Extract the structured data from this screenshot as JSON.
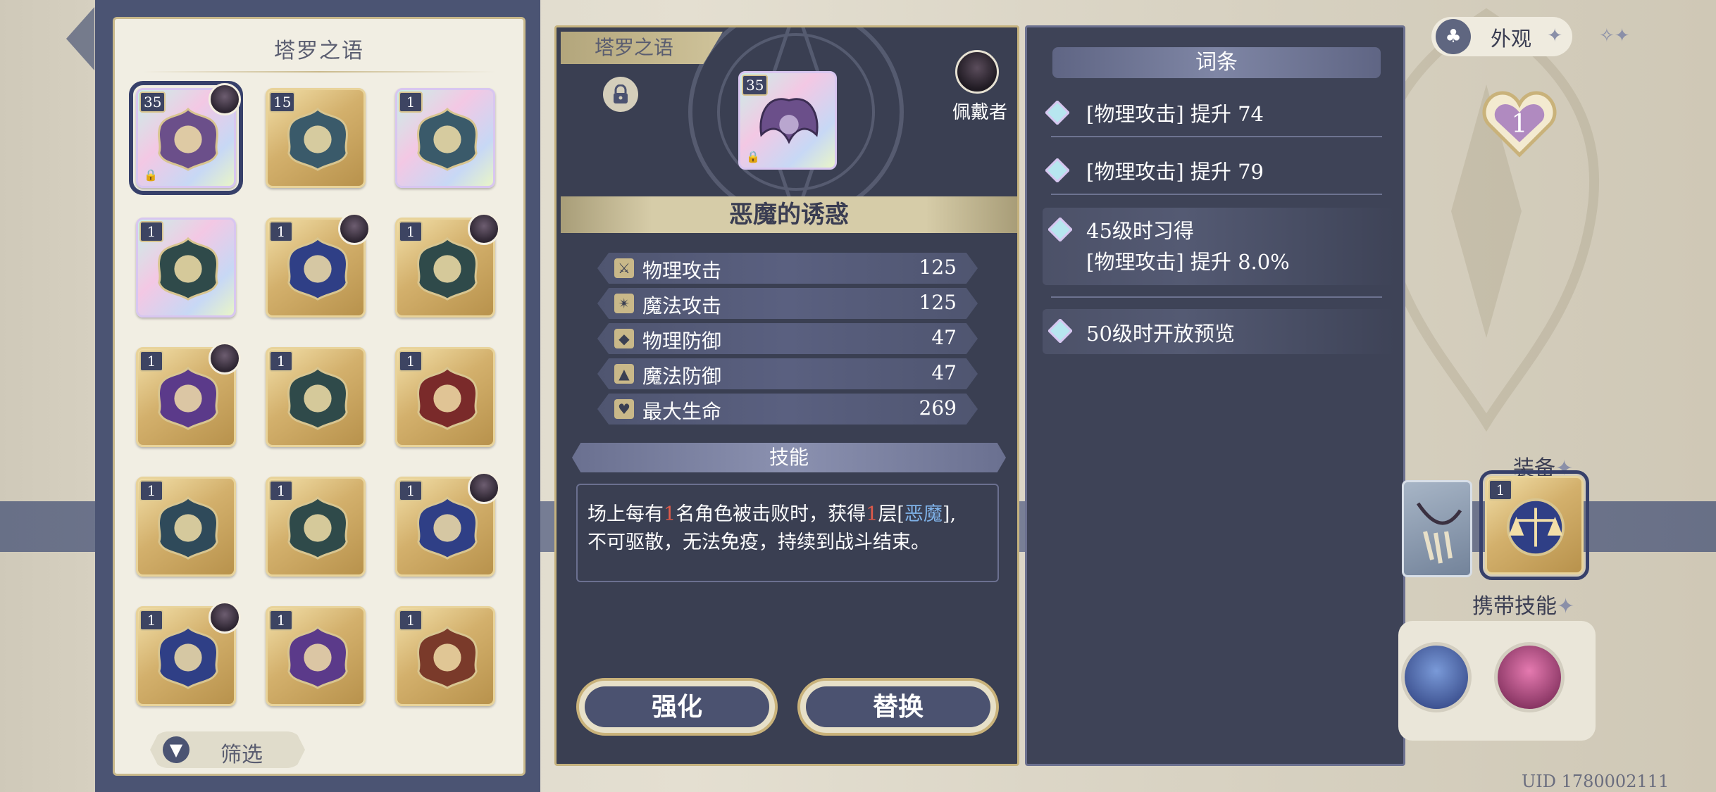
{
  "inventory": {
    "title": "塔罗之语",
    "filter_label": "筛选",
    "cards": [
      {
        "level": "35",
        "rainbow": true,
        "avatar": true,
        "lock": true,
        "selected": true,
        "motif": "demon-wing-icon"
      },
      {
        "level": "15",
        "rainbow": false,
        "avatar": false,
        "lock": false,
        "selected": false,
        "motif": "sword-icon"
      },
      {
        "level": "1",
        "rainbow": true,
        "avatar": false,
        "lock": false,
        "selected": false,
        "motif": "sword-icon"
      },
      {
        "level": "1",
        "rainbow": true,
        "avatar": false,
        "lock": false,
        "selected": false,
        "motif": "wreath-icon"
      },
      {
        "level": "1",
        "rainbow": false,
        "avatar": true,
        "lock": false,
        "selected": false,
        "motif": "scales-icon"
      },
      {
        "level": "1",
        "rainbow": false,
        "avatar": true,
        "lock": false,
        "selected": false,
        "motif": "bell-icon"
      },
      {
        "level": "1",
        "rainbow": false,
        "avatar": true,
        "lock": false,
        "selected": false,
        "motif": "moon-star-icon"
      },
      {
        "level": "1",
        "rainbow": false,
        "avatar": false,
        "lock": false,
        "selected": false,
        "motif": "wreath-icon"
      },
      {
        "level": "1",
        "rainbow": false,
        "avatar": false,
        "lock": false,
        "selected": false,
        "motif": "crown-icon"
      },
      {
        "level": "1",
        "rainbow": false,
        "avatar": false,
        "lock": false,
        "selected": false,
        "motif": "wheel-icon"
      },
      {
        "level": "1",
        "rainbow": false,
        "avatar": false,
        "lock": false,
        "selected": false,
        "motif": "bell-icon"
      },
      {
        "level": "1",
        "rainbow": false,
        "avatar": true,
        "lock": false,
        "selected": false,
        "motif": "scales-icon"
      },
      {
        "level": "1",
        "rainbow": false,
        "avatar": true,
        "lock": false,
        "selected": false,
        "motif": "scroll-icon"
      },
      {
        "level": "1",
        "rainbow": false,
        "avatar": false,
        "lock": false,
        "selected": false,
        "motif": "moon-star-icon"
      },
      {
        "level": "1",
        "rainbow": false,
        "avatar": false,
        "lock": false,
        "selected": false,
        "motif": "hourglass-icon"
      }
    ]
  },
  "detail": {
    "tab_label": "塔罗之语",
    "item_level": "35",
    "wearer_label": "佩戴者",
    "item_name": "恶魔的诱惑",
    "stats": [
      {
        "icon": "sword-icon",
        "label": "物理攻击",
        "value": "125"
      },
      {
        "icon": "wand-icon",
        "label": "魔法攻击",
        "value": "125"
      },
      {
        "icon": "shield-icon",
        "label": "物理防御",
        "value": "47"
      },
      {
        "icon": "wizard-hat-icon",
        "label": "魔法防御",
        "value": "47"
      },
      {
        "icon": "heart-icon",
        "label": "最大生命",
        "value": "269"
      }
    ],
    "skill_header": "技能",
    "skill_text": {
      "p1": "场上每有",
      "n1": "1",
      "p2": "名角色被击败时，获得",
      "n2": "1",
      "p3": "层[",
      "keyword": "恶魔",
      "p4": "],",
      "line2": "不可驱散，无法免疫，持续到战斗结束。"
    },
    "enhance_label": "强化",
    "replace_label": "替换"
  },
  "affix": {
    "header": "词条",
    "rows": [
      "[物理攻击] 提升 74",
      "[物理攻击] 提升 79"
    ],
    "unlock_45_title": "45级时习得",
    "unlock_45_text": "[物理攻击] 提升 8.0%",
    "unlock_50": "50级时开放预览"
  },
  "hud": {
    "appearance_label": "外观",
    "heart_level": "1",
    "equip_label": "装备",
    "equip_slot_level": "1",
    "carry_skill_label": "携带技能",
    "uid": "UID 1780002111"
  },
  "colors": {
    "panel_dark": "#3a3f52",
    "gold": "#c9b27a",
    "accent_red": "#e05a4a",
    "accent_blue": "#7fb2e8"
  }
}
